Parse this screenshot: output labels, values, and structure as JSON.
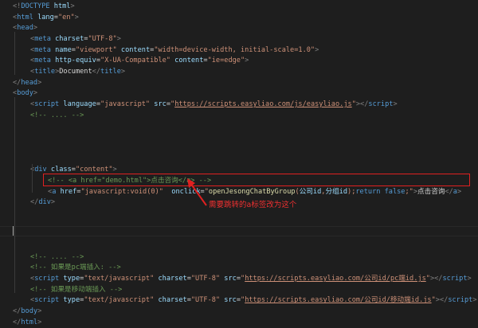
{
  "editor": {
    "lines": [
      {
        "indent": 0,
        "tokens": [
          [
            "punct",
            "<!"
          ],
          [
            "tag",
            "DOCTYPE"
          ],
          [
            "text",
            " "
          ],
          [
            "attr",
            "html"
          ],
          [
            "punct",
            ">"
          ]
        ]
      },
      {
        "indent": 0,
        "tokens": [
          [
            "punct",
            "<"
          ],
          [
            "tag",
            "html"
          ],
          [
            "text",
            " "
          ],
          [
            "attr",
            "lang"
          ],
          [
            "text",
            "="
          ],
          [
            "str",
            "\"en\""
          ],
          [
            "punct",
            ">"
          ]
        ]
      },
      {
        "indent": 0,
        "tokens": [
          [
            "punct",
            "<"
          ],
          [
            "tag",
            "head"
          ],
          [
            "punct",
            ">"
          ]
        ]
      },
      {
        "indent": 1,
        "tokens": [
          [
            "punct",
            "<"
          ],
          [
            "tag",
            "meta"
          ],
          [
            "text",
            " "
          ],
          [
            "attr",
            "charset"
          ],
          [
            "text",
            "="
          ],
          [
            "str",
            "\"UTF-8\""
          ],
          [
            "punct",
            ">"
          ]
        ]
      },
      {
        "indent": 1,
        "tokens": [
          [
            "punct",
            "<"
          ],
          [
            "tag",
            "meta"
          ],
          [
            "text",
            " "
          ],
          [
            "attr",
            "name"
          ],
          [
            "text",
            "="
          ],
          [
            "str",
            "\"viewport\""
          ],
          [
            "text",
            " "
          ],
          [
            "attr",
            "content"
          ],
          [
            "text",
            "="
          ],
          [
            "str",
            "\"width=device-width, initial-scale=1.0\""
          ],
          [
            "punct",
            ">"
          ]
        ]
      },
      {
        "indent": 1,
        "tokens": [
          [
            "punct",
            "<"
          ],
          [
            "tag",
            "meta"
          ],
          [
            "text",
            " "
          ],
          [
            "attr",
            "http-equiv"
          ],
          [
            "text",
            "="
          ],
          [
            "str",
            "\"X-UA-Compatible\""
          ],
          [
            "text",
            " "
          ],
          [
            "attr",
            "content"
          ],
          [
            "text",
            "="
          ],
          [
            "str",
            "\"ie=edge\""
          ],
          [
            "punct",
            ">"
          ]
        ]
      },
      {
        "indent": 1,
        "tokens": [
          [
            "punct",
            "<"
          ],
          [
            "tag",
            "title"
          ],
          [
            "punct",
            ">"
          ],
          [
            "text",
            "Document"
          ],
          [
            "punct",
            "</"
          ],
          [
            "tag",
            "title"
          ],
          [
            "punct",
            ">"
          ]
        ]
      },
      {
        "indent": 0,
        "tokens": [
          [
            "punct",
            "</"
          ],
          [
            "tag",
            "head"
          ],
          [
            "punct",
            ">"
          ]
        ]
      },
      {
        "indent": 0,
        "tokens": [
          [
            "punct",
            "<"
          ],
          [
            "tag",
            "body"
          ],
          [
            "punct",
            ">"
          ]
        ]
      },
      {
        "indent": 1,
        "tokens": [
          [
            "punct",
            "<"
          ],
          [
            "tag",
            "script"
          ],
          [
            "text",
            " "
          ],
          [
            "attr",
            "language"
          ],
          [
            "text",
            "="
          ],
          [
            "str",
            "\"javascript\""
          ],
          [
            "text",
            " "
          ],
          [
            "attr",
            "src"
          ],
          [
            "text",
            "="
          ],
          [
            "str",
            "\""
          ],
          [
            "link",
            "https://scripts.easyliao.com/js/easyliao.js"
          ],
          [
            "str",
            "\""
          ],
          [
            "punct",
            "></"
          ],
          [
            "tag",
            "script"
          ],
          [
            "punct",
            ">"
          ]
        ]
      },
      {
        "indent": 1,
        "tokens": [
          [
            "comment",
            "<!-- .... -->"
          ]
        ]
      },
      {
        "indent": 0,
        "tokens": []
      },
      {
        "indent": 0,
        "tokens": []
      },
      {
        "indent": 0,
        "tokens": []
      },
      {
        "indent": 0,
        "tokens": []
      },
      {
        "indent": 1,
        "tokens": [
          [
            "punct",
            "<"
          ],
          [
            "tag",
            "div"
          ],
          [
            "text",
            " "
          ],
          [
            "attr",
            "class"
          ],
          [
            "text",
            "="
          ],
          [
            "str",
            "\"content\""
          ],
          [
            "punct",
            ">"
          ]
        ]
      },
      {
        "indent": 2,
        "tokens": [
          [
            "comment",
            "<!-- <a href=\"demo.html\">点击咨询</a> -->"
          ]
        ]
      },
      {
        "indent": 2,
        "tokens": [
          [
            "punct",
            "<"
          ],
          [
            "tag",
            "a"
          ],
          [
            "text",
            " "
          ],
          [
            "attr",
            "href"
          ],
          [
            "text",
            "="
          ],
          [
            "str",
            "\"javascript:void(0)\""
          ],
          [
            "text",
            "  "
          ],
          [
            "attr",
            "onclick"
          ],
          [
            "text",
            "="
          ],
          [
            "str",
            "\""
          ],
          [
            "fn",
            "openJesongChatByGroup"
          ],
          [
            "str",
            "("
          ],
          [
            "var",
            "公司id"
          ],
          [
            "str",
            ","
          ],
          [
            "var",
            "分组id"
          ],
          [
            "str",
            ");"
          ],
          [
            "kw",
            "return"
          ],
          [
            "str",
            " "
          ],
          [
            "kw",
            "false"
          ],
          [
            "str",
            ";\""
          ],
          [
            "punct",
            ">"
          ],
          [
            "text",
            "点击咨询"
          ],
          [
            "punct",
            "</"
          ],
          [
            "tag",
            "a"
          ],
          [
            "punct",
            ">"
          ]
        ]
      },
      {
        "indent": 1,
        "tokens": [
          [
            "punct",
            "</"
          ],
          [
            "tag",
            "div"
          ],
          [
            "punct",
            ">"
          ]
        ]
      },
      {
        "indent": 0,
        "tokens": []
      },
      {
        "indent": 0,
        "tokens": []
      },
      {
        "indent": 0,
        "tokens": []
      },
      {
        "indent": 0,
        "tokens": []
      },
      {
        "indent": 1,
        "tokens": [
          [
            "comment",
            "<!-- .... -->"
          ]
        ]
      },
      {
        "indent": 1,
        "tokens": [
          [
            "comment",
            "<!-- 如果是pc端插入: -->"
          ]
        ]
      },
      {
        "indent": 1,
        "tokens": [
          [
            "punct",
            "<"
          ],
          [
            "tag",
            "script"
          ],
          [
            "text",
            " "
          ],
          [
            "attr",
            "type"
          ],
          [
            "text",
            "="
          ],
          [
            "str",
            "\"text/javascript\""
          ],
          [
            "text",
            " "
          ],
          [
            "attr",
            "charset"
          ],
          [
            "text",
            "="
          ],
          [
            "str",
            "\"UTF-8\""
          ],
          [
            "text",
            " "
          ],
          [
            "attr",
            "src"
          ],
          [
            "text",
            "="
          ],
          [
            "str",
            "\""
          ],
          [
            "link",
            "https://scripts.easyliao.com/公司id/pc端id.js"
          ],
          [
            "str",
            "\""
          ],
          [
            "punct",
            "></"
          ],
          [
            "tag",
            "script"
          ],
          [
            "punct",
            ">"
          ]
        ]
      },
      {
        "indent": 1,
        "tokens": [
          [
            "comment",
            "<!-- 如果是移动端插入 -->"
          ]
        ]
      },
      {
        "indent": 1,
        "tokens": [
          [
            "punct",
            "<"
          ],
          [
            "tag",
            "script"
          ],
          [
            "text",
            " "
          ],
          [
            "attr",
            "type"
          ],
          [
            "text",
            "="
          ],
          [
            "str",
            "\"text/javascript\""
          ],
          [
            "text",
            " "
          ],
          [
            "attr",
            "charset"
          ],
          [
            "text",
            "="
          ],
          [
            "str",
            "\"UTF-8\""
          ],
          [
            "text",
            " "
          ],
          [
            "attr",
            "src"
          ],
          [
            "text",
            "="
          ],
          [
            "str",
            "\""
          ],
          [
            "link",
            "https://scripts.easyliao.com/公司id/移动端id.js"
          ],
          [
            "str",
            "\""
          ],
          [
            "punct",
            "></"
          ],
          [
            "tag",
            "script"
          ],
          [
            "punct",
            ">"
          ]
        ]
      },
      {
        "indent": 0,
        "tokens": [
          [
            "punct",
            "</"
          ],
          [
            "tag",
            "body"
          ],
          [
            "punct",
            ">"
          ]
        ]
      },
      {
        "indent": 0,
        "tokens": [
          [
            "punct",
            "</"
          ],
          [
            "tag",
            "html"
          ],
          [
            "punct",
            ">"
          ]
        ]
      }
    ],
    "colors": {
      "background": "#1e1e1e",
      "annotation": "#e02020"
    }
  },
  "annotation": {
    "text": "需要跳转的a标签改为这个"
  }
}
